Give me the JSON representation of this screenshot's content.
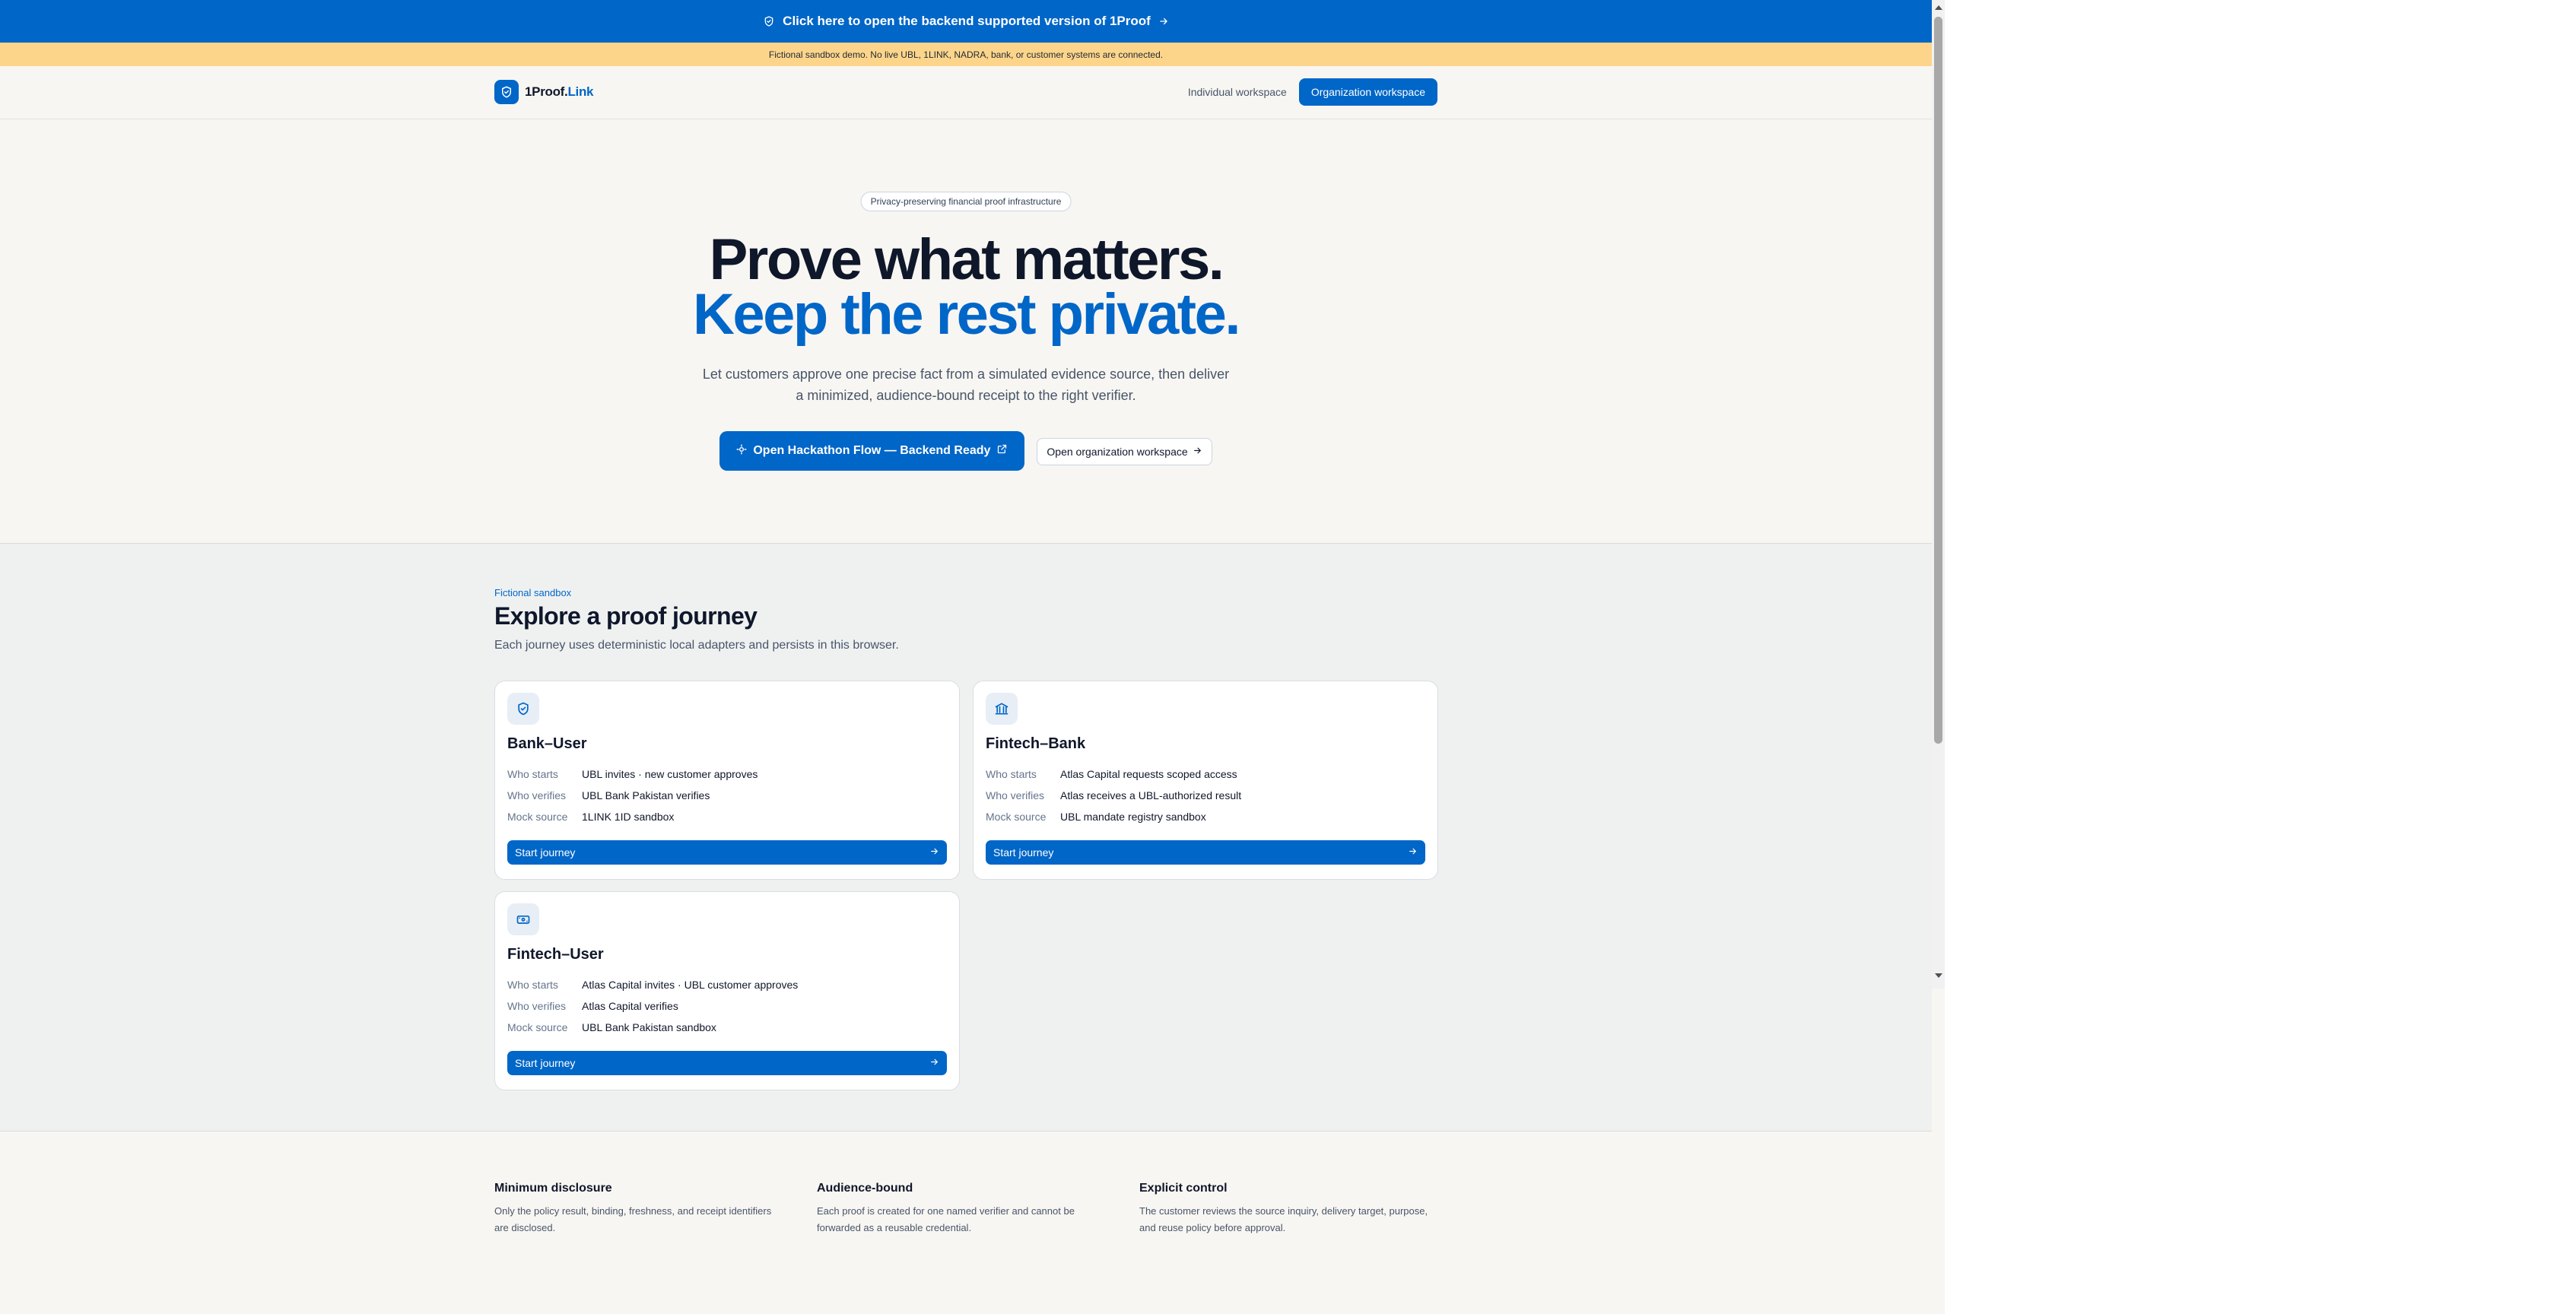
{
  "banner": {
    "text": "Click here to open the backend supported version of 1Proof"
  },
  "warning": {
    "text": "Fictional sandbox demo. No live UBL, 1LINK, NADRA, bank, or customer systems are connected."
  },
  "nav": {
    "logo_main": "1Proof.",
    "logo_accent": "Link",
    "individual": "Individual workspace",
    "organization": "Organization workspace"
  },
  "hero": {
    "pill": "Privacy-preserving financial proof infrastructure",
    "line1": "Prove what matters.",
    "line2": "Keep the rest private.",
    "lede": "Let customers approve one precise fact from a simulated evidence source, then deliver a minimized, audience-bound receipt to the right verifier.",
    "cta_primary": "Open Hackathon Flow — Backend Ready",
    "cta_secondary": "Open organization workspace"
  },
  "journeys": {
    "eyebrow": "Fictional sandbox",
    "title": "Explore a proof journey",
    "subtitle": "Each journey uses deterministic local adapters and persists in this browser.",
    "labels": {
      "starts": "Who starts",
      "verifies": "Who verifies",
      "source": "Mock source"
    },
    "cards": [
      {
        "title": "Bank–User",
        "icon": "shield-icon",
        "starts": "UBL invites · new customer approves",
        "verifies": "UBL Bank Pakistan verifies",
        "source": "1LINK 1ID sandbox",
        "button": "Start journey"
      },
      {
        "title": "Fintech–Bank",
        "icon": "bank-icon",
        "starts": "Atlas Capital requests scoped access",
        "verifies": "Atlas receives a UBL-authorized result",
        "source": "UBL mandate registry sandbox",
        "button": "Start journey"
      },
      {
        "title": "Fintech–User",
        "icon": "wallet-icon",
        "starts": "Atlas Capital invites · UBL customer approves",
        "verifies": "Atlas Capital verifies",
        "source": "UBL Bank Pakistan sandbox",
        "button": "Start journey"
      }
    ]
  },
  "features": [
    {
      "title": "Minimum disclosure",
      "body": "Only the policy result, binding, freshness, and receipt identifiers are disclosed."
    },
    {
      "title": "Audience-bound",
      "body": "Each proof is created for one named verifier and cannot be forwarded as a reusable credential."
    },
    {
      "title": "Explicit control",
      "body": "The customer reviews the source inquiry, delivery target, purpose, and reuse policy before approval."
    }
  ],
  "colors": {
    "brand": "#0066c8",
    "warning": "#fdd58a",
    "background": "#f8f6f2"
  }
}
